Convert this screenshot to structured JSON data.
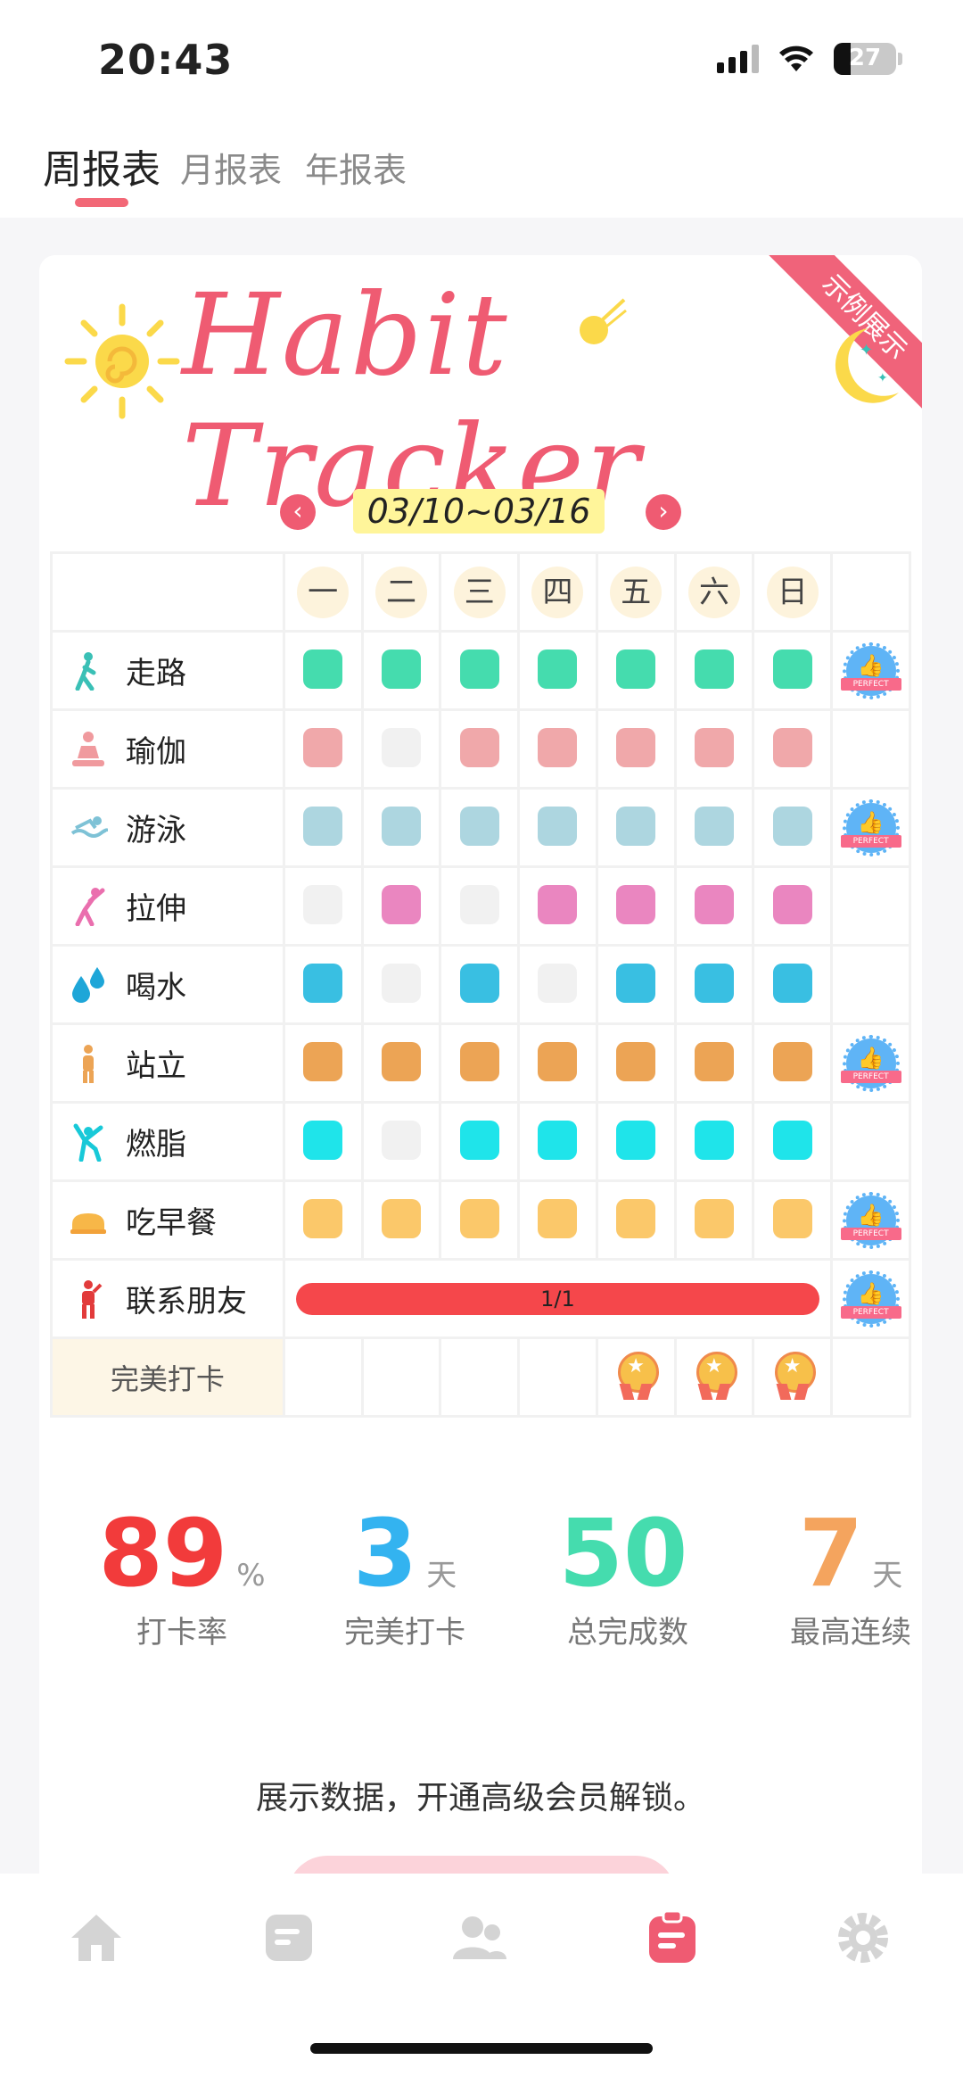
{
  "status_bar": {
    "time": "20:43",
    "battery": "27"
  },
  "tabs": [
    {
      "label": "周报表"
    },
    {
      "label": "月报表"
    },
    {
      "label": "年报表"
    }
  ],
  "card": {
    "ribbon": "示例展示",
    "title_art": "Habit Tracker",
    "date_range": "03/10~03/16",
    "days": [
      "一",
      "二",
      "三",
      "四",
      "五",
      "六",
      "日"
    ],
    "habits": [
      {
        "name": "走路",
        "icon": "walking-icon",
        "color": "#45dcae",
        "done": [
          1,
          1,
          1,
          1,
          1,
          1,
          1
        ],
        "perfect": true
      },
      {
        "name": "瑜伽",
        "icon": "yoga-icon",
        "color": "#f0a8aa",
        "done": [
          1,
          0,
          1,
          1,
          1,
          1,
          1
        ],
        "perfect": false
      },
      {
        "name": "游泳",
        "icon": "swimming-icon",
        "color": "#add6e0",
        "done": [
          1,
          1,
          1,
          1,
          1,
          1,
          1
        ],
        "perfect": true
      },
      {
        "name": "拉伸",
        "icon": "stretch-icon",
        "color": "#ea86c0",
        "done": [
          0,
          1,
          0,
          1,
          1,
          1,
          1
        ],
        "perfect": false
      },
      {
        "name": "喝水",
        "icon": "water-drop-icon",
        "color": "#39bfe2",
        "done": [
          1,
          0,
          1,
          0,
          1,
          1,
          1
        ],
        "perfect": false
      },
      {
        "name": "站立",
        "icon": "standing-icon",
        "color": "#eca455",
        "done": [
          1,
          1,
          1,
          1,
          1,
          1,
          1
        ],
        "perfect": true
      },
      {
        "name": "燃脂",
        "icon": "fat-burn-icon",
        "color": "#1fe4ea",
        "done": [
          1,
          0,
          1,
          1,
          1,
          1,
          1
        ],
        "perfect": false
      },
      {
        "name": "吃早餐",
        "icon": "bread-icon",
        "color": "#fbc86a",
        "done": [
          1,
          1,
          1,
          1,
          1,
          1,
          1
        ],
        "perfect": true
      }
    ],
    "friends_row": {
      "name": "联系朋友",
      "icon": "contact-friend-icon",
      "progress": "1/1",
      "perfect": true
    },
    "perfect_label": "完美打卡",
    "perfect_days": [
      0,
      0,
      0,
      0,
      1,
      1,
      1
    ],
    "perfect_badge_text": "PERFECT",
    "stats": [
      {
        "value": "89",
        "unit": "%",
        "label": "打卡率",
        "color": "#f23b3b"
      },
      {
        "value": "3",
        "unit": "天",
        "label": "完美打卡",
        "color": "#33b3f0"
      },
      {
        "value": "50",
        "unit": "",
        "label": "总完成数",
        "color": "#45dcae"
      },
      {
        "value": "7",
        "unit": "天",
        "label": "最高连续",
        "color": "#f4a45e"
      }
    ],
    "unlock_text": "展示数据，开通高级会员解锁。"
  },
  "tabbar": [
    "home-icon",
    "notes-icon",
    "friends-icon",
    "report-icon",
    "settings-icon"
  ],
  "colors": {
    "accent": "#f26877",
    "empty_cell": "#f1f1f1"
  }
}
